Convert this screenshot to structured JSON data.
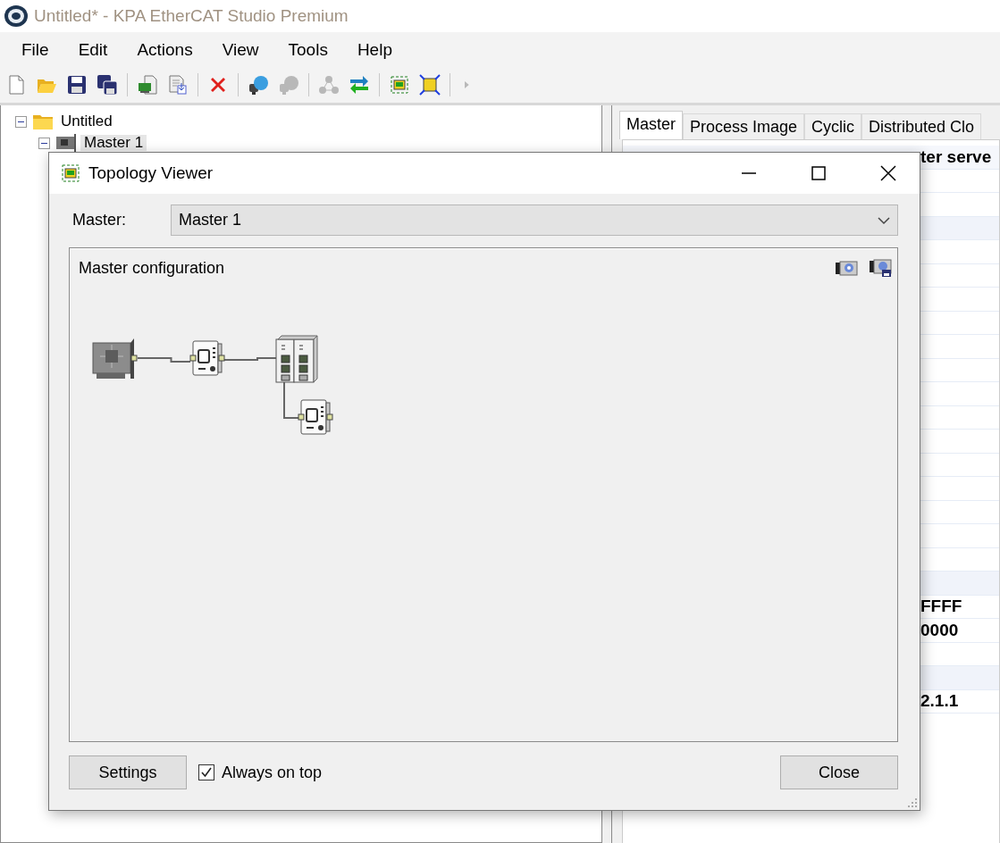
{
  "window": {
    "title": "Untitled* - KPA EtherCAT Studio Premium"
  },
  "menu": [
    "File",
    "Edit",
    "Actions",
    "View",
    "Tools",
    "Help"
  ],
  "toolbar": [
    {
      "kind": "new",
      "disabled": false
    },
    {
      "kind": "open",
      "disabled": false
    },
    {
      "kind": "save",
      "disabled": false
    },
    {
      "kind": "save-all",
      "disabled": false
    },
    {
      "kind": "separator"
    },
    {
      "kind": "card",
      "disabled": false
    },
    {
      "kind": "import",
      "disabled": false
    },
    {
      "kind": "separator"
    },
    {
      "kind": "delete",
      "disabled": false
    },
    {
      "kind": "separator"
    },
    {
      "kind": "connect",
      "disabled": false
    },
    {
      "kind": "connect",
      "disabled": true
    },
    {
      "kind": "separator"
    },
    {
      "kind": "network",
      "disabled": true
    },
    {
      "kind": "swap",
      "disabled": false
    },
    {
      "kind": "separator"
    },
    {
      "kind": "topology",
      "disabled": false
    },
    {
      "kind": "fit",
      "disabled": false
    },
    {
      "kind": "separator"
    },
    {
      "kind": "arrow",
      "disabled": true
    }
  ],
  "tree": [
    {
      "label": "Untitled",
      "kind": "folder",
      "expanded": true,
      "selected": false,
      "children": [
        {
          "label": "Master 1",
          "kind": "master",
          "expanded": true,
          "selected": true
        }
      ]
    }
  ],
  "right_panel": {
    "tabs": [
      {
        "label": "Master",
        "selected": true
      },
      {
        "label": "Process Image",
        "selected": false
      },
      {
        "label": "Cyclic",
        "selected": false
      },
      {
        "label": "Distributed Clo",
        "selected": false
      }
    ],
    "rows": [
      {
        "kind": "header",
        "value": "ter serve"
      },
      {
        "kind": "field"
      },
      {
        "kind": "field"
      },
      {
        "kind": "group"
      },
      {
        "kind": "field"
      },
      {
        "kind": "field"
      },
      {
        "kind": "field"
      },
      {
        "kind": "field"
      },
      {
        "kind": "field"
      },
      {
        "kind": "field"
      },
      {
        "kind": "field"
      },
      {
        "kind": "field"
      },
      {
        "kind": "field"
      },
      {
        "kind": "field"
      },
      {
        "kind": "field"
      },
      {
        "kind": "field"
      },
      {
        "kind": "field"
      },
      {
        "kind": "field"
      },
      {
        "kind": "group"
      },
      {
        "kind": "field",
        "value": "FFFF"
      },
      {
        "kind": "field",
        "value": "0000"
      },
      {
        "kind": "field"
      },
      {
        "kind": "group"
      },
      {
        "kind": "field",
        "value": "2.1.1"
      }
    ]
  },
  "dialog": {
    "title": "Topology Viewer",
    "master_label": "Master:",
    "master_value": "Master 1",
    "group_title": "Master configuration",
    "topology": {
      "nodes": [
        {
          "kind": "network-card"
        },
        {
          "kind": "io-module"
        },
        {
          "kind": "coupler"
        },
        {
          "kind": "io-module"
        }
      ]
    },
    "settings_button": "Settings",
    "always_on_top": {
      "label": "Always on top",
      "checked": true
    },
    "close_button": "Close"
  }
}
